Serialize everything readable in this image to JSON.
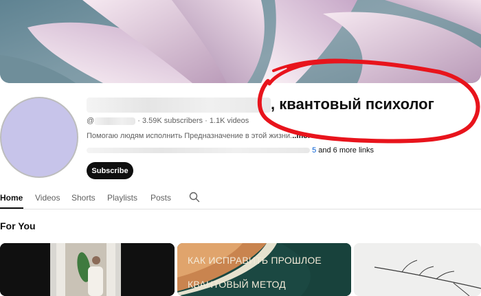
{
  "channel": {
    "title_visible": ", квантовый психолог",
    "handle_prefix": "@",
    "subscribers": "3.59K subscribers",
    "videos": "1.1K videos",
    "separator": "·",
    "description": "Помогаю людям исполнить Предназначение в этой жизни.",
    "more_label": "..more",
    "link_fragment": "5",
    "more_links": "and 6 more links",
    "avatar_color": "#c7c4ea"
  },
  "actions": {
    "subscribe_label": "Subscribe"
  },
  "tabs": [
    {
      "label": "Home",
      "active": true
    },
    {
      "label": "Videos"
    },
    {
      "label": "Shorts"
    },
    {
      "label": "Playlists"
    },
    {
      "label": "Posts"
    }
  ],
  "section": {
    "title": "For You"
  },
  "cards": [
    {
      "lines": []
    },
    {
      "lines": [
        "КАК ИСПРАВИТЬ ПРОШЛОЕ",
        "КВАНТОВЫЙ МЕТОД"
      ]
    },
    {
      "lines": []
    }
  ],
  "colors": {
    "annotation_red": "#e8141c",
    "link_blue": "#065fd4",
    "dark": "#0f0f0f"
  },
  "icons": {
    "search": "search-icon"
  }
}
